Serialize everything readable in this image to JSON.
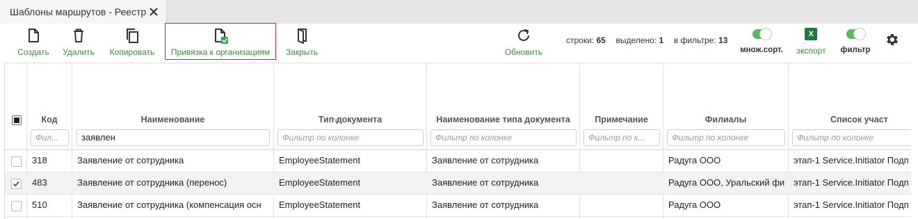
{
  "tab": {
    "title": "Шаблоны маршрутов - Реестр",
    "close_icon": "close-icon"
  },
  "toolbar": {
    "create": "Создать",
    "delete": "Удалить",
    "copy": "Копировать",
    "bind_org": "Привязка к организациям",
    "close": "Закрыть",
    "refresh": "Обновить",
    "rows_label": "строки:",
    "rows_value": "65",
    "selected_label": "выделено:",
    "selected_value": "1",
    "filtered_label": "в фильтре:",
    "filtered_value": "13",
    "multisort": "множ.сорт.",
    "export": "экспорт",
    "excel_glyph": "X",
    "filter": "фильтр",
    "accent": "#3f8a3a",
    "highlight": "#d9222a"
  },
  "grid": {
    "columns": [
      {
        "title": "Код",
        "filter": "Фил..."
      },
      {
        "title": "Наименование",
        "filter": "заявлен",
        "sort_marker": "Y"
      },
      {
        "title": "Тип документа",
        "filter": "Фильтр по колонке"
      },
      {
        "title": "Наименование типа документа",
        "filter": "Фильтр по колонке"
      },
      {
        "title": "Примечание",
        "filter": "Фильтр по к..."
      },
      {
        "title": "Филиалы",
        "filter": "Фильтр по колонке"
      },
      {
        "title": "Список участ",
        "filter": "Фильтр по колонке"
      }
    ],
    "rows": [
      {
        "checked": false,
        "code": "318",
        "name": "Заявление от сотрудника",
        "doc_type": "EmployeeStatement",
        "doc_type_name": "Заявление от сотрудника",
        "note": "",
        "branches": "Радуга ООО",
        "participants": "этап-1 Service.Initiator Подп"
      },
      {
        "checked": true,
        "code": "483",
        "name": "Заявление от сотрудника (перенос)",
        "doc_type": "EmployeeStatement",
        "doc_type_name": "Заявление от сотрудника",
        "note": "",
        "branches": "Радуга ООО, Уральский фи",
        "participants": "этап-1 Service.Initiator Подп"
      },
      {
        "checked": false,
        "code": "510",
        "name": "Заявление от сотрудника (компенсация осн",
        "doc_type": "EmployeeStatement",
        "doc_type_name": "Заявление от сотрудника",
        "note": "",
        "branches": "Радуга ООО",
        "participants": "этап-1 Service.Initiator Подп"
      }
    ]
  }
}
